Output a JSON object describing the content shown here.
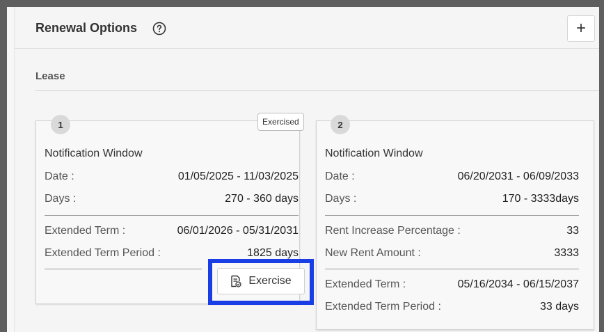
{
  "header": {
    "title": "Renewal Options",
    "add_label": "+"
  },
  "section": {
    "label": "Lease"
  },
  "cards": [
    {
      "number": "1",
      "status": "Exercised",
      "title": "Notification Window",
      "date_label": "Date :",
      "date_value": "01/05/2025 - 11/03/2025",
      "days_label": "Days :",
      "days_value": "270 - 360 days",
      "extended_term_label": "Extended Term :",
      "extended_term_value": "06/01/2026 - 05/31/2031",
      "extended_term_period_label": "Extended Term Period :",
      "extended_term_period_value": "1825 days",
      "action_label": "Exercise"
    },
    {
      "number": "2",
      "title": "Notification Window",
      "date_label": "Date :",
      "date_value": "06/20/2031 - 06/09/2033",
      "days_label": "Days :",
      "days_value": "170 - 3333days",
      "rent_increase_label": "Rent Increase Percentage :",
      "rent_increase_value": "33",
      "new_rent_label": "New Rent Amount :",
      "new_rent_value": "3333",
      "extended_term_label": "Extended Term :",
      "extended_term_value": "05/16/2034 - 06/15/2037",
      "extended_term_period_label": "Extended Term Period :",
      "extended_term_period_value": "33 days"
    }
  ],
  "icons": {
    "help": "help-circle-icon",
    "exercise": "document-check-icon"
  },
  "colors": {
    "focus_highlight": "#1a3ee6"
  }
}
